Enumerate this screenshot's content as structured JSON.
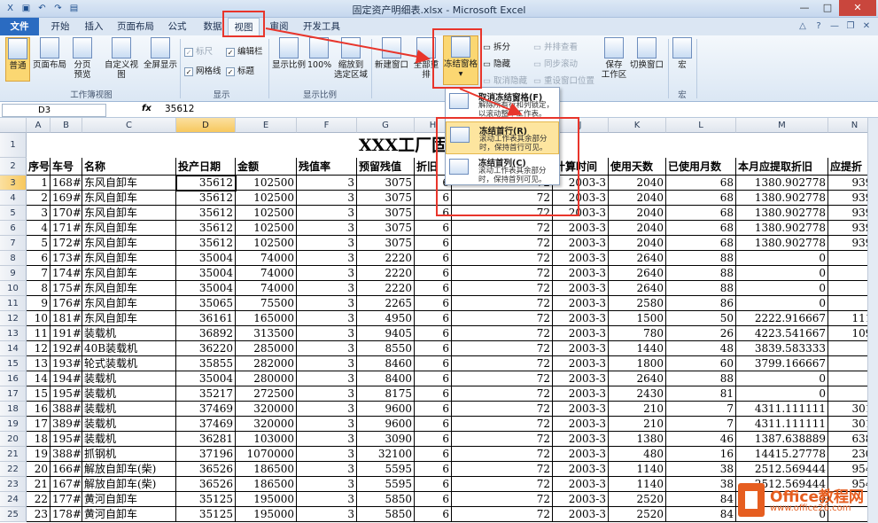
{
  "window": {
    "title": "固定资产明细表.xlsx - Microsoft Excel"
  },
  "tabs": [
    "文件",
    "开始",
    "插入",
    "页面布局",
    "公式",
    "数据",
    "视图",
    "审阅",
    "开发工具"
  ],
  "ribbon": {
    "workbook_views": {
      "normal": "普通",
      "page_layout": "页面布局",
      "page_break": "分页\n预览",
      "custom": "自定义视图",
      "fullscreen": "全屏显示",
      "label": "工作簿视图"
    },
    "show": {
      "ruler": "标尺",
      "edit_bar": "编辑栏",
      "gridlines": "网格线",
      "headings": "标题",
      "label": "显示"
    },
    "zoom": {
      "zoom": "显示比例",
      "hundred": "100%",
      "zoom_sel": "缩放到\n选定区域",
      "label": "显示比例"
    },
    "window": {
      "new_window": "新建窗口",
      "arrange_all": "全部重排",
      "freeze_panes": "冻结窗格",
      "split": "拆分",
      "hide": "隐藏",
      "unhide": "取消隐藏",
      "side_by_side": "并排查看",
      "sync_scroll": "同步滚动",
      "reset_pos": "重设窗口位置",
      "save_ws": "保存\n工作区",
      "switch": "切换窗口"
    },
    "macros": {
      "macro": "宏",
      "label": "宏"
    }
  },
  "formula_bar": {
    "name_box": "D3",
    "fx": "fx",
    "value": "35612"
  },
  "dropdown": [
    {
      "title": "取消冻结窗格(F)",
      "desc": "解除所有行和列锁定，以滚动整个工作表。"
    },
    {
      "title": "冻结首行(R)",
      "desc": "滚动工作表其余部分时，保持首行可见。"
    },
    {
      "title": "冻结首列(C)",
      "desc": "滚动工作表其余部分时，保持首列可见。"
    }
  ],
  "sheet": {
    "col_letters": [
      "A",
      "B",
      "C",
      "D",
      "E",
      "F",
      "G",
      "H",
      "I",
      "J",
      "K",
      "L",
      "M",
      "N"
    ],
    "title": "XXX工厂固定资产明细表",
    "headers": [
      "序号",
      "车号",
      "名称",
      "投产日期",
      "金额",
      "残值率",
      "预留残值",
      "折旧",
      "",
      "计算时间",
      "使用天数",
      "已使用月数",
      "本月应提取折旧",
      "应提折"
    ],
    "rows": [
      [
        "1",
        "168#",
        "东风自卸车",
        "35612",
        "102500",
        "3",
        "3075",
        "6",
        "72",
        "2003-3",
        "2040",
        "68",
        "1380.902778",
        "9390"
      ],
      [
        "2",
        "169#",
        "东风自卸车",
        "35612",
        "102500",
        "3",
        "3075",
        "6",
        "72",
        "2003-3",
        "2040",
        "68",
        "1380.902778",
        "9390"
      ],
      [
        "3",
        "170#",
        "东风自卸车",
        "35612",
        "102500",
        "3",
        "3075",
        "6",
        "72",
        "2003-3",
        "2040",
        "68",
        "1380.902778",
        "9390"
      ],
      [
        "4",
        "171#",
        "东风自卸车",
        "35612",
        "102500",
        "3",
        "3075",
        "6",
        "72",
        "2003-3",
        "2040",
        "68",
        "1380.902778",
        "9390"
      ],
      [
        "5",
        "172#",
        "东风自卸车",
        "35612",
        "102500",
        "3",
        "3075",
        "6",
        "72",
        "2003-3",
        "2040",
        "68",
        "1380.902778",
        "9390"
      ],
      [
        "6",
        "173#",
        "东风自卸车",
        "35004",
        "74000",
        "3",
        "2220",
        "6",
        "72",
        "2003-3",
        "2640",
        "88",
        "0",
        ""
      ],
      [
        "7",
        "174#",
        "东风自卸车",
        "35004",
        "74000",
        "3",
        "2220",
        "6",
        "72",
        "2003-3",
        "2640",
        "88",
        "0",
        ""
      ],
      [
        "8",
        "175#",
        "东风自卸车",
        "35004",
        "74000",
        "3",
        "2220",
        "6",
        "72",
        "2003-3",
        "2640",
        "88",
        "0",
        ""
      ],
      [
        "9",
        "176#",
        "东风自卸车",
        "35065",
        "75500",
        "3",
        "2265",
        "6",
        "72",
        "2003-3",
        "2580",
        "86",
        "0",
        ""
      ],
      [
        "10",
        "181#",
        "东风自卸车",
        "36161",
        "165000",
        "3",
        "4950",
        "6",
        "72",
        "2003-3",
        "1500",
        "50",
        "2222.916667",
        "1111"
      ],
      [
        "11",
        "191#",
        "装载机",
        "36892",
        "313500",
        "3",
        "9405",
        "6",
        "72",
        "2003-3",
        "780",
        "26",
        "4223.541667",
        "1098"
      ],
      [
        "12",
        "192#",
        "40B装载机",
        "36220",
        "285000",
        "3",
        "8550",
        "6",
        "72",
        "2003-3",
        "1440",
        "48",
        "3839.583333",
        ""
      ],
      [
        "13",
        "193#",
        "轮式装载机",
        "35855",
        "282000",
        "3",
        "8460",
        "6",
        "72",
        "2003-3",
        "1800",
        "60",
        "3799.166667",
        ""
      ],
      [
        "14",
        "194#",
        "装载机",
        "35004",
        "280000",
        "3",
        "8400",
        "6",
        "72",
        "2003-3",
        "2640",
        "88",
        "0",
        ""
      ],
      [
        "15",
        "195#",
        "装载机",
        "35217",
        "272500",
        "3",
        "8175",
        "6",
        "72",
        "2003-3",
        "2430",
        "81",
        "0",
        ""
      ],
      [
        "16",
        "388#",
        "装载机",
        "37469",
        "320000",
        "3",
        "9600",
        "6",
        "72",
        "2003-3",
        "210",
        "7",
        "4311.111111",
        "3017"
      ],
      [
        "17",
        "389#",
        "装载机",
        "37469",
        "320000",
        "3",
        "9600",
        "6",
        "72",
        "2003-3",
        "210",
        "7",
        "4311.111111",
        "3017"
      ],
      [
        "18",
        "195#",
        "装载机",
        "36281",
        "103000",
        "3",
        "3090",
        "6",
        "72",
        "2003-3",
        "1380",
        "46",
        "1387.638889",
        "6383"
      ],
      [
        "19",
        "388#",
        "抓钢机",
        "37196",
        "1070000",
        "3",
        "32100",
        "6",
        "72",
        "2003-3",
        "480",
        "16",
        "14415.27778",
        "2306"
      ],
      [
        "20",
        "166#",
        "解放自卸车(柴)",
        "36526",
        "186500",
        "3",
        "5595",
        "6",
        "72",
        "2003-3",
        "1140",
        "38",
        "2512.569444",
        "9547"
      ],
      [
        "21",
        "167#",
        "解放自卸车(柴)",
        "36526",
        "186500",
        "3",
        "5595",
        "6",
        "72",
        "2003-3",
        "1140",
        "38",
        "2512.569444",
        "9547"
      ],
      [
        "22",
        "177#",
        "黄河自卸车",
        "35125",
        "195000",
        "3",
        "5850",
        "6",
        "72",
        "2003-3",
        "2520",
        "84",
        "0",
        ""
      ],
      [
        "23",
        "178#",
        "黄河自卸车",
        "35125",
        "195000",
        "3",
        "5850",
        "6",
        "72",
        "2003-3",
        "2520",
        "84",
        "0",
        ""
      ]
    ]
  },
  "watermark": {
    "brand": "Office教程网",
    "url": "www.office26.com"
  }
}
